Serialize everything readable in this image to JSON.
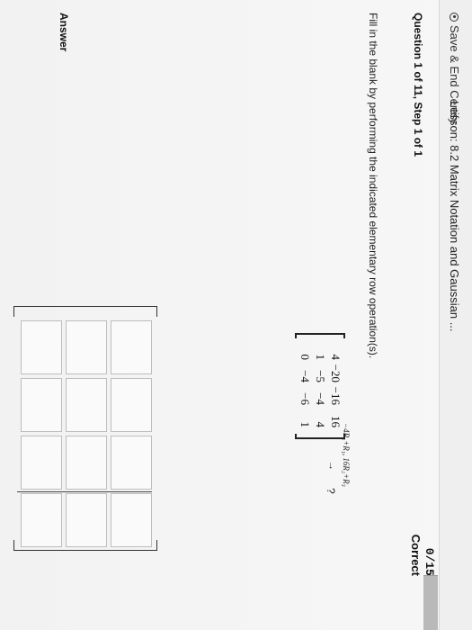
{
  "header": {
    "save_label": "Save & End Certify",
    "lesson_title": "Lesson: 8.2 Matrix Notation and Gaussian ..."
  },
  "question": {
    "info": "Question 1 of 11, Step 1 of 1",
    "score": "0/15",
    "status": "Correct",
    "instruction": "Fill in the blank by performing the indicated elementary row operation(s).",
    "matrix": [
      [
        "4",
        "−20",
        "−16",
        "16"
      ],
      [
        "1",
        "−5",
        "−4",
        "4"
      ],
      [
        "0",
        "−4",
        "−6",
        "1"
      ]
    ],
    "operation": "−4R₂+R₁, 16R₂+R₃",
    "arrow": "→",
    "question_mark": "?"
  },
  "answer": {
    "label": "Answer"
  }
}
